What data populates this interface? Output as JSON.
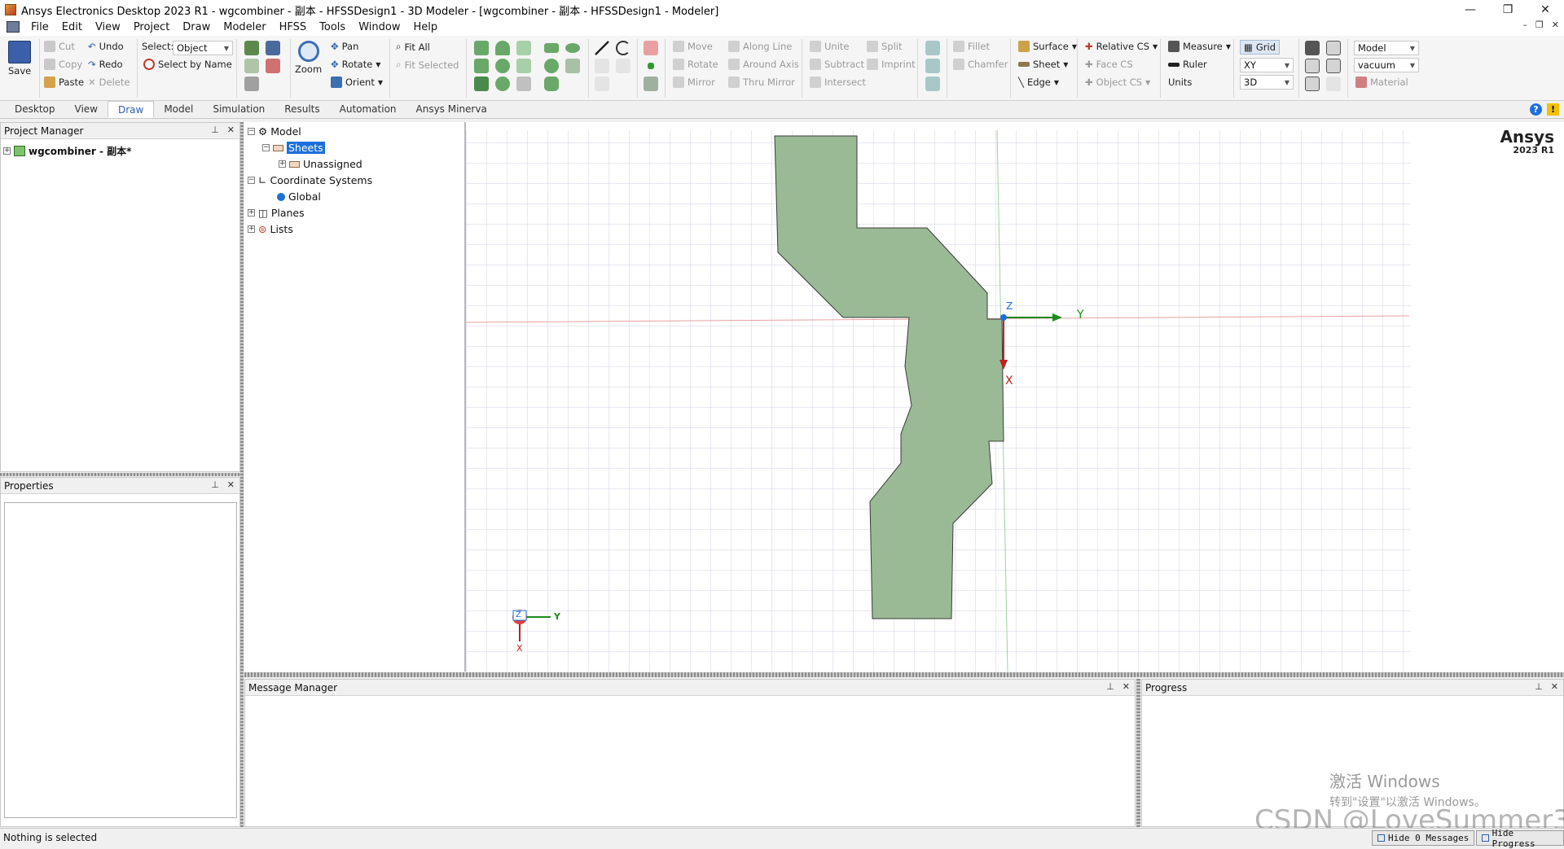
{
  "window": {
    "title": "Ansys Electronics Desktop 2023 R1 - wgcombiner - 副本 - HFSSDesign1 - 3D Modeler - [wgcombiner - 副本 - HFSSDesign1 - Modeler]",
    "min": "—",
    "max": "❐",
    "close": "✕"
  },
  "menu": {
    "items": [
      "File",
      "Edit",
      "View",
      "Project",
      "Draw",
      "Modeler",
      "HFSS",
      "Tools",
      "Window",
      "Help"
    ],
    "mdi_min": "–",
    "mdi_restore": "❐",
    "mdi_close": "✕"
  },
  "ribbon": {
    "save": "Save",
    "cut": "Cut",
    "copy": "Copy",
    "paste": "Paste",
    "undo": "Undo",
    "redo": "Redo",
    "delete": "Delete",
    "select_label": "Select:",
    "select_value": "Object",
    "select_by_name": "Select by Name",
    "zoom": "Zoom",
    "pan": "Pan",
    "rotate": "Rotate",
    "orient": "Orient",
    "fit_all": "Fit All",
    "fit_selected": "Fit Selected",
    "move": "Move",
    "rotate2": "Rotate",
    "mirror": "Mirror",
    "along_line": "Along Line",
    "around_axis": "Around Axis",
    "thru_mirror": "Thru Mirror",
    "unite": "Unite",
    "subtract": "Subtract",
    "intersect": "Intersect",
    "split": "Split",
    "imprint": "Imprint",
    "fillet": "Fillet",
    "chamfer": "Chamfer",
    "surface": "Surface",
    "sheet": "Sheet",
    "edge": "Edge",
    "relative_cs": "Relative CS",
    "face_cs": "Face CS",
    "object_cs": "Object CS",
    "measure": "Measure",
    "ruler": "Ruler",
    "units": "Units",
    "grid": "Grid",
    "plane": "XY",
    "mode": "3D",
    "model": "Model",
    "material_value": "vacuum",
    "material": "Material"
  },
  "tabs": [
    "Desktop",
    "View",
    "Draw",
    "Model",
    "Simulation",
    "Results",
    "Automation",
    "Ansys Minerva"
  ],
  "active_tab": "Draw",
  "project_manager": {
    "title": "Project Manager",
    "project": "wgcombiner - 副本*"
  },
  "properties": {
    "title": "Properties"
  },
  "tree": {
    "model": "Model",
    "sheets": "Sheets",
    "unassigned": "Unassigned",
    "coord_systems": "Coordinate Systems",
    "global": "Global",
    "planes": "Planes",
    "lists": "Lists"
  },
  "viewport": {
    "brand": "Ansys",
    "version": "2023 R1",
    "axis_z": "Z",
    "axis_y": "Y",
    "axis_x": "X",
    "shape_color": "#9aba95"
  },
  "message_manager": {
    "title": "Message Manager"
  },
  "progress": {
    "title": "Progress"
  },
  "status": {
    "text": "Nothing is selected",
    "hide_messages": "Hide 0 Messages",
    "hide_progress": "Hide Progress"
  },
  "watermark": {
    "line1": "激活 Windows",
    "line2": "转到\"设置\"以激活 Windows。",
    "csdn": "CSDN @LoveSummer3"
  }
}
